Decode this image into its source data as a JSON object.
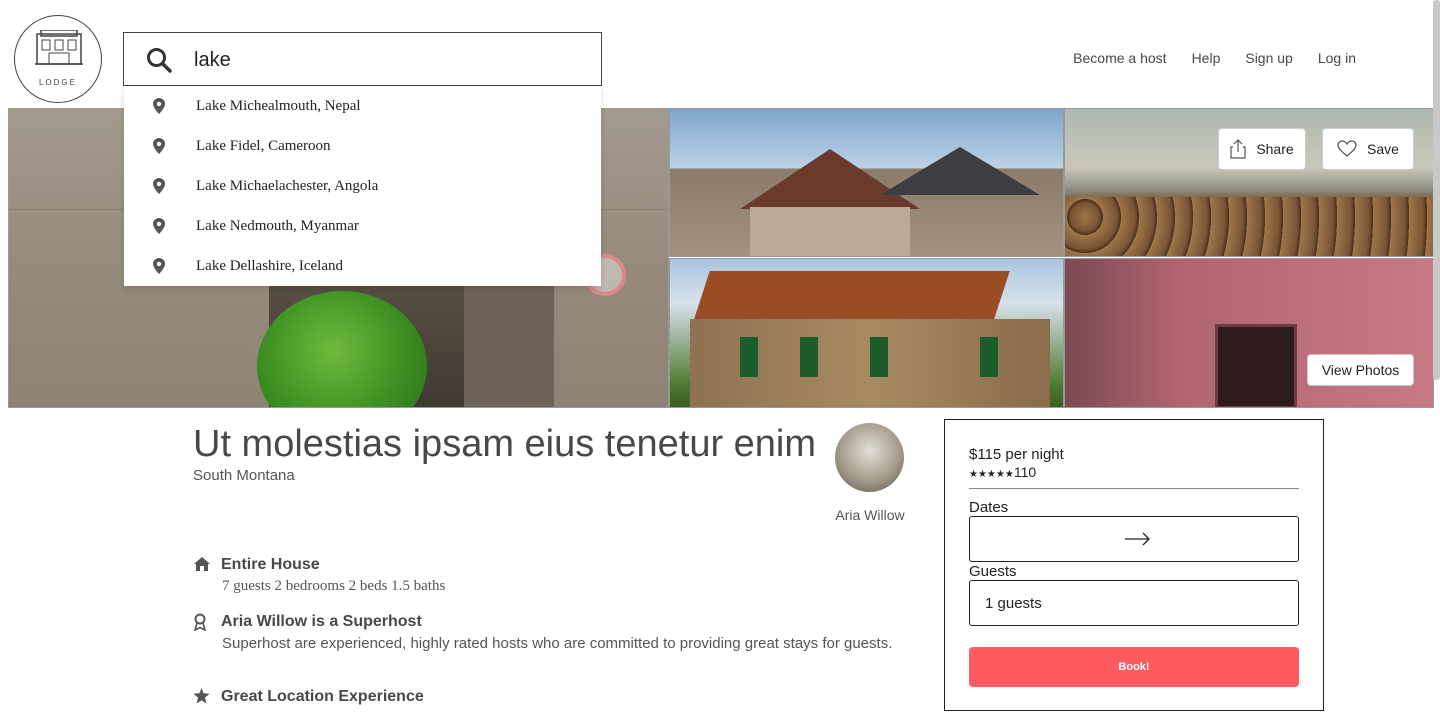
{
  "logo": {
    "text": "LODGE"
  },
  "search": {
    "value": "lake"
  },
  "nav": {
    "become_host": "Become a host",
    "help": "Help",
    "sign_up": "Sign up",
    "log_in": "Log in"
  },
  "suggestions": [
    "Lake Michealmouth, Nepal",
    "Lake Fidel, Cameroon",
    "Lake Michaelachester, Angola",
    "Lake Nedmouth, Myanmar",
    "Lake Dellashire, Iceland"
  ],
  "gallery": {
    "share": "Share",
    "save": "Save",
    "view_photos": "View Photos"
  },
  "listing": {
    "title": "Ut molestias ipsam eius tenetur enim",
    "location": "South Montana",
    "host_name": "Aria Willow"
  },
  "features": [
    {
      "icon": "home-icon",
      "title": "Entire House",
      "desc": "7 guests  2 bedrooms  2 beds  1.5 baths"
    },
    {
      "icon": "award-icon",
      "title": "Aria Willow is a Superhost",
      "desc": "Superhost are experienced, highly rated hosts who are committed to providing great stays for guests."
    },
    {
      "icon": "star-icon",
      "title": "Great Location Experience",
      "desc": ""
    }
  ],
  "booking": {
    "price": "$115 per night",
    "stars": "★★★★★",
    "reviews": "110",
    "dates_label": "Dates",
    "guests_label": "Guests",
    "guests_value": "1 guests",
    "book_label": "Book!",
    "accent_color": "#ff5a5f"
  }
}
